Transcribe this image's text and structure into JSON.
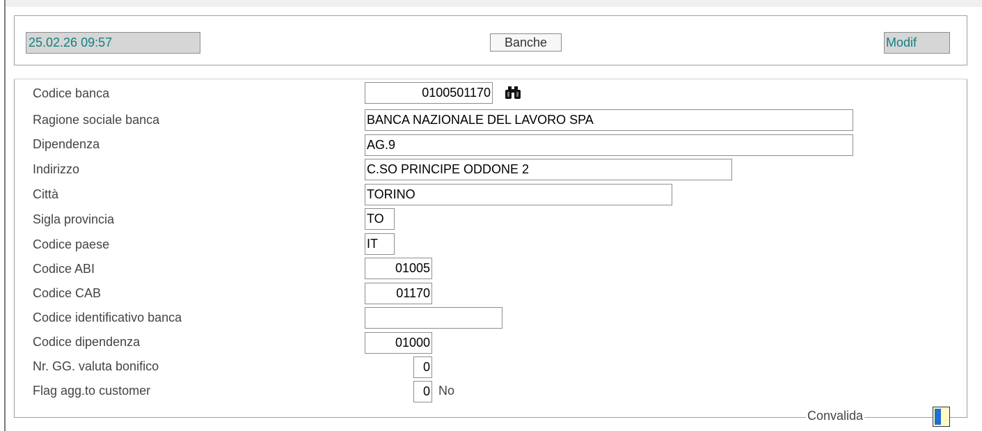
{
  "header": {
    "timestamp": "25.02.26 09:57",
    "title": "Banche",
    "mode": "Modif"
  },
  "form": {
    "codice_banca": {
      "label": "Codice banca",
      "value": "0100501170"
    },
    "ragione_sociale": {
      "label": "Ragione sociale banca",
      "value": "BANCA NAZIONALE DEL LAVORO SPA"
    },
    "dipendenza": {
      "label": "Dipendenza",
      "value": "AG.9"
    },
    "indirizzo": {
      "label": "Indirizzo",
      "value": "C.SO PRINCIPE ODDONE 2"
    },
    "citta": {
      "label": "Città",
      "value": "TORINO"
    },
    "sigla_provincia": {
      "label": "Sigla  provincia",
      "value": "TO"
    },
    "codice_paese": {
      "label": "Codice paese",
      "value": "IT"
    },
    "codice_abi": {
      "label": "Codice ABI",
      "value": "01005"
    },
    "codice_cab": {
      "label": "Codice CAB",
      "value": "01170"
    },
    "codice_identificativo": {
      "label": "Codice identificativo banca",
      "value": ""
    },
    "codice_dipendenza": {
      "label": "Codice dipendenza",
      "value": "01000"
    },
    "gg_valuta": {
      "label": "Nr. GG. valuta bonifico",
      "value": "0"
    },
    "flag_customer": {
      "label": "Flag agg.to customer",
      "value": "0",
      "value_text": "No"
    }
  },
  "footer": {
    "convalida_label": "Convalida"
  },
  "icons": {
    "search": "binoculars-icon",
    "confirm": "convalida-icon"
  },
  "colors": {
    "status_text": "#118080",
    "status_bg": "#d6d6d6",
    "confirm_fill": "#fff8c8",
    "confirm_bar": "#1e6fd0"
  }
}
